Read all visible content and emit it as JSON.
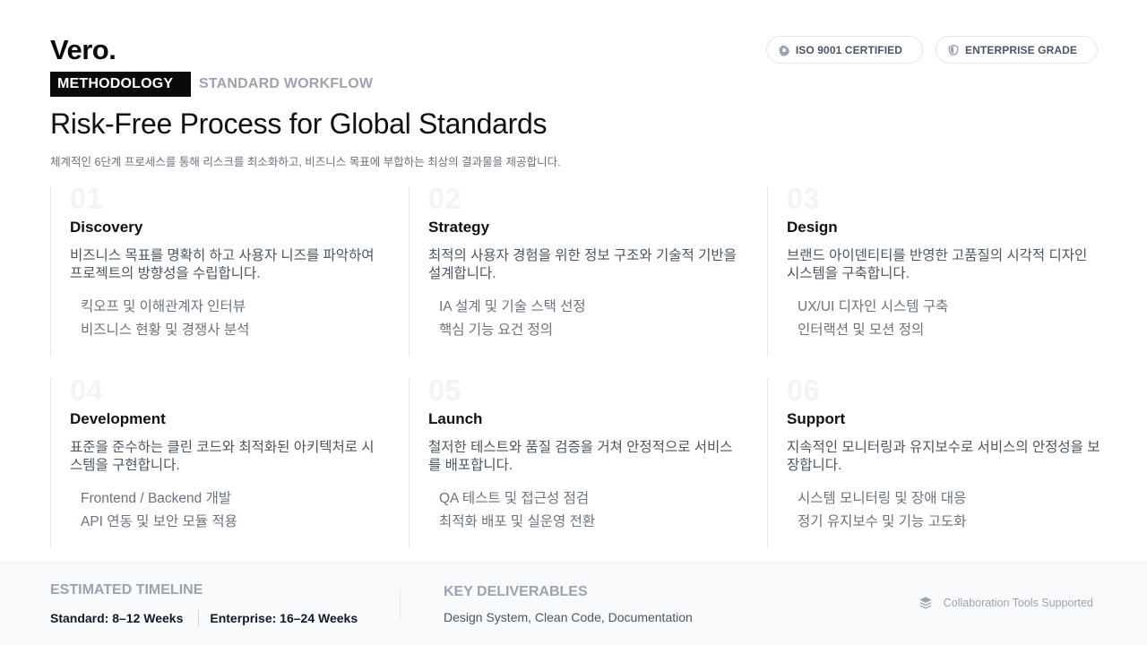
{
  "brand": {
    "logo": "Vero.",
    "tag_primary": "METHODOLOGY",
    "tag_secondary": "STANDARD WORKFLOW"
  },
  "badges": [
    {
      "icon": "gear-icon",
      "label": "ISO 9001 CERTIFIED"
    },
    {
      "icon": "shield-icon",
      "label": "ENTERPRISE GRADE"
    }
  ],
  "hero": {
    "title": "Risk-Free Process for Global Standards",
    "subtitle": "체계적인 6단계 프로세스를 통해 리스크를 최소화하고, 비즈니스 목표에 부합하는 최상의 결과물을 제공합니다."
  },
  "steps": [
    {
      "number": "01",
      "title": "Discovery",
      "description": "비즈니스 목표를 명확히 하고 사용자 니즈를 파악하여 프로젝트의 방향성을 수립합니다.",
      "items": [
        "킥오프 및 이해관계자 인터뷰",
        "비즈니스 현황 및 경쟁사 분석"
      ]
    },
    {
      "number": "02",
      "title": "Strategy",
      "description": "최적의 사용자 경험을 위한 정보 구조와 기술적 기반을 설계합니다.",
      "items": [
        "IA 설계 및 기술 스택 선정",
        "핵심 기능 요건 정의"
      ]
    },
    {
      "number": "03",
      "title": "Design",
      "description": "브랜드 아이덴티티를 반영한 고품질의 시각적 디자인 시스템을 구축합니다.",
      "items": [
        "UX/UI 디자인 시스템 구축",
        "인터랙션 및 모션 정의"
      ]
    },
    {
      "number": "04",
      "title": "Development",
      "description": "표준을 준수하는 클린 코드와 최적화된 아키텍처로 시스템을 구현합니다.",
      "items": [
        "Frontend / Backend 개발",
        "API 연동 및 보안 모듈 적용"
      ]
    },
    {
      "number": "05",
      "title": "Launch",
      "description": "철저한 테스트와 품질 검증을 거쳐 안정적으로 서비스를 배포합니다.",
      "items": [
        "QA 테스트 및 접근성 점검",
        "최적화 배포 및 실운영 전환"
      ]
    },
    {
      "number": "06",
      "title": "Support",
      "description": "지속적인 모니터링과 유지보수로 서비스의 안정성을 보장합니다.",
      "items": [
        "시스템 모니터링 및 장애 대응",
        "정기 유지보수 및 기능 고도화"
      ]
    }
  ],
  "footer": {
    "timeline_label": "ESTIMATED TIMELINE",
    "timeline_standard": "Standard: 8–12 Weeks",
    "timeline_enterprise": "Enterprise: 16–24 Weeks",
    "deliverables_label": "KEY DELIVERABLES",
    "deliverables_value": "Design System, Clean Code, Documentation",
    "collab_icon": "layers-icon",
    "collab_text": "Collaboration Tools Supported"
  }
}
